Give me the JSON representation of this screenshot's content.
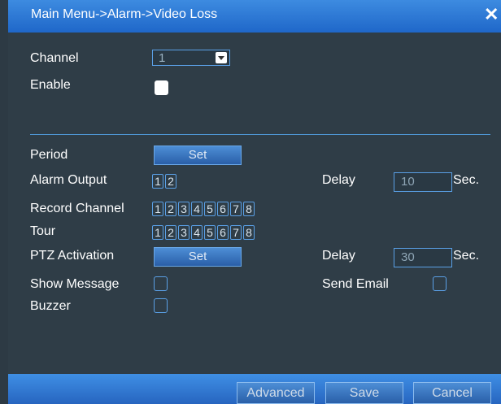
{
  "window": {
    "title": "Main Menu->Alarm->Video Loss",
    "close_glyph": "✕"
  },
  "fields": {
    "channel_label": "Channel",
    "channel_value": "1",
    "enable_label": "Enable",
    "enable_checked": true,
    "period_label": "Period",
    "period_button": "Set",
    "alarm_output_label": "Alarm Output",
    "alarm_outputs": [
      "1",
      "2"
    ],
    "alarm_delay_label": "Delay",
    "alarm_delay_value": "10",
    "alarm_delay_unit": "Sec.",
    "record_channel_label": "Record Channel",
    "record_channels": [
      "1",
      "2",
      "3",
      "4",
      "5",
      "6",
      "7",
      "8"
    ],
    "tour_label": "Tour",
    "tour_channels": [
      "1",
      "2",
      "3",
      "4",
      "5",
      "6",
      "7",
      "8"
    ],
    "ptz_label": "PTZ Activation",
    "ptz_button": "Set",
    "ptz_delay_label": "Delay",
    "ptz_delay_value": "30",
    "ptz_delay_unit": "Sec.",
    "show_message_label": "Show Message",
    "send_email_label": "Send Email",
    "buzzer_label": "Buzzer"
  },
  "footer": {
    "advanced": "Advanced",
    "save": "Save",
    "cancel": "Cancel"
  },
  "colors": {
    "accent": "#5aa0e6",
    "title_bar": "#2a75d6",
    "background": "#2f3d47"
  }
}
